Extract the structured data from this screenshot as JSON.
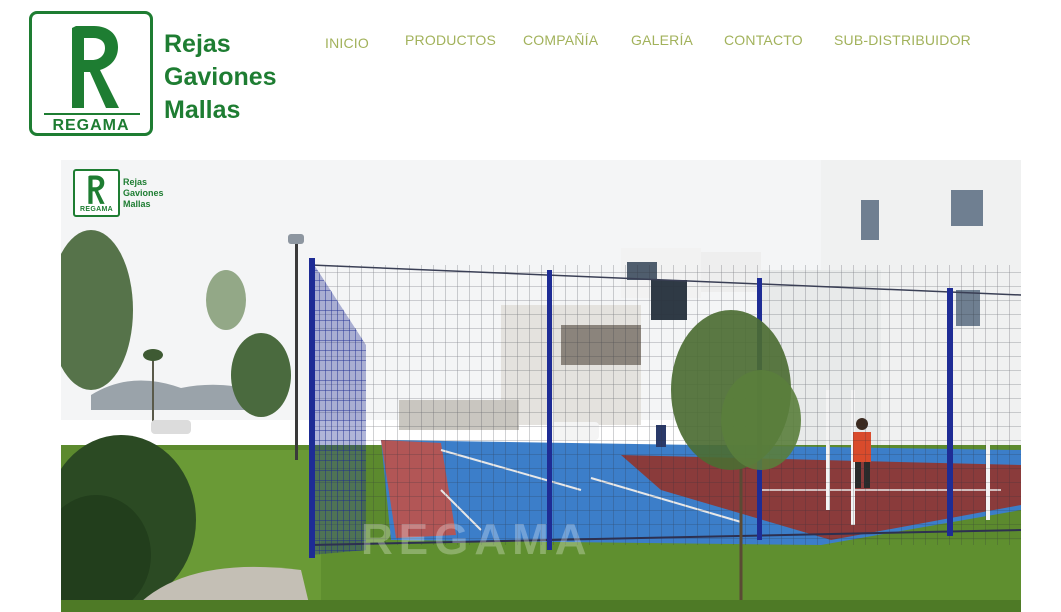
{
  "brand": {
    "name": "REGAMA",
    "letter": "R",
    "tagline": [
      "Rejas",
      "Gaviones",
      "Mallas"
    ],
    "color": "#1e7d32"
  },
  "nav": {
    "color": "#a2b25b",
    "items": [
      "INICIO",
      "PRODUCTOS",
      "COMPAÑÍA",
      "GALERÍA",
      "CONTACTO",
      "SUB-DISTRIBUIDOR"
    ]
  },
  "hero": {
    "overlay_logo": {
      "letter": "R",
      "name": "REGAMA",
      "tagline": [
        "Rejas",
        "Gaviones",
        "Mallas"
      ]
    },
    "watermark": "REGAMA"
  }
}
